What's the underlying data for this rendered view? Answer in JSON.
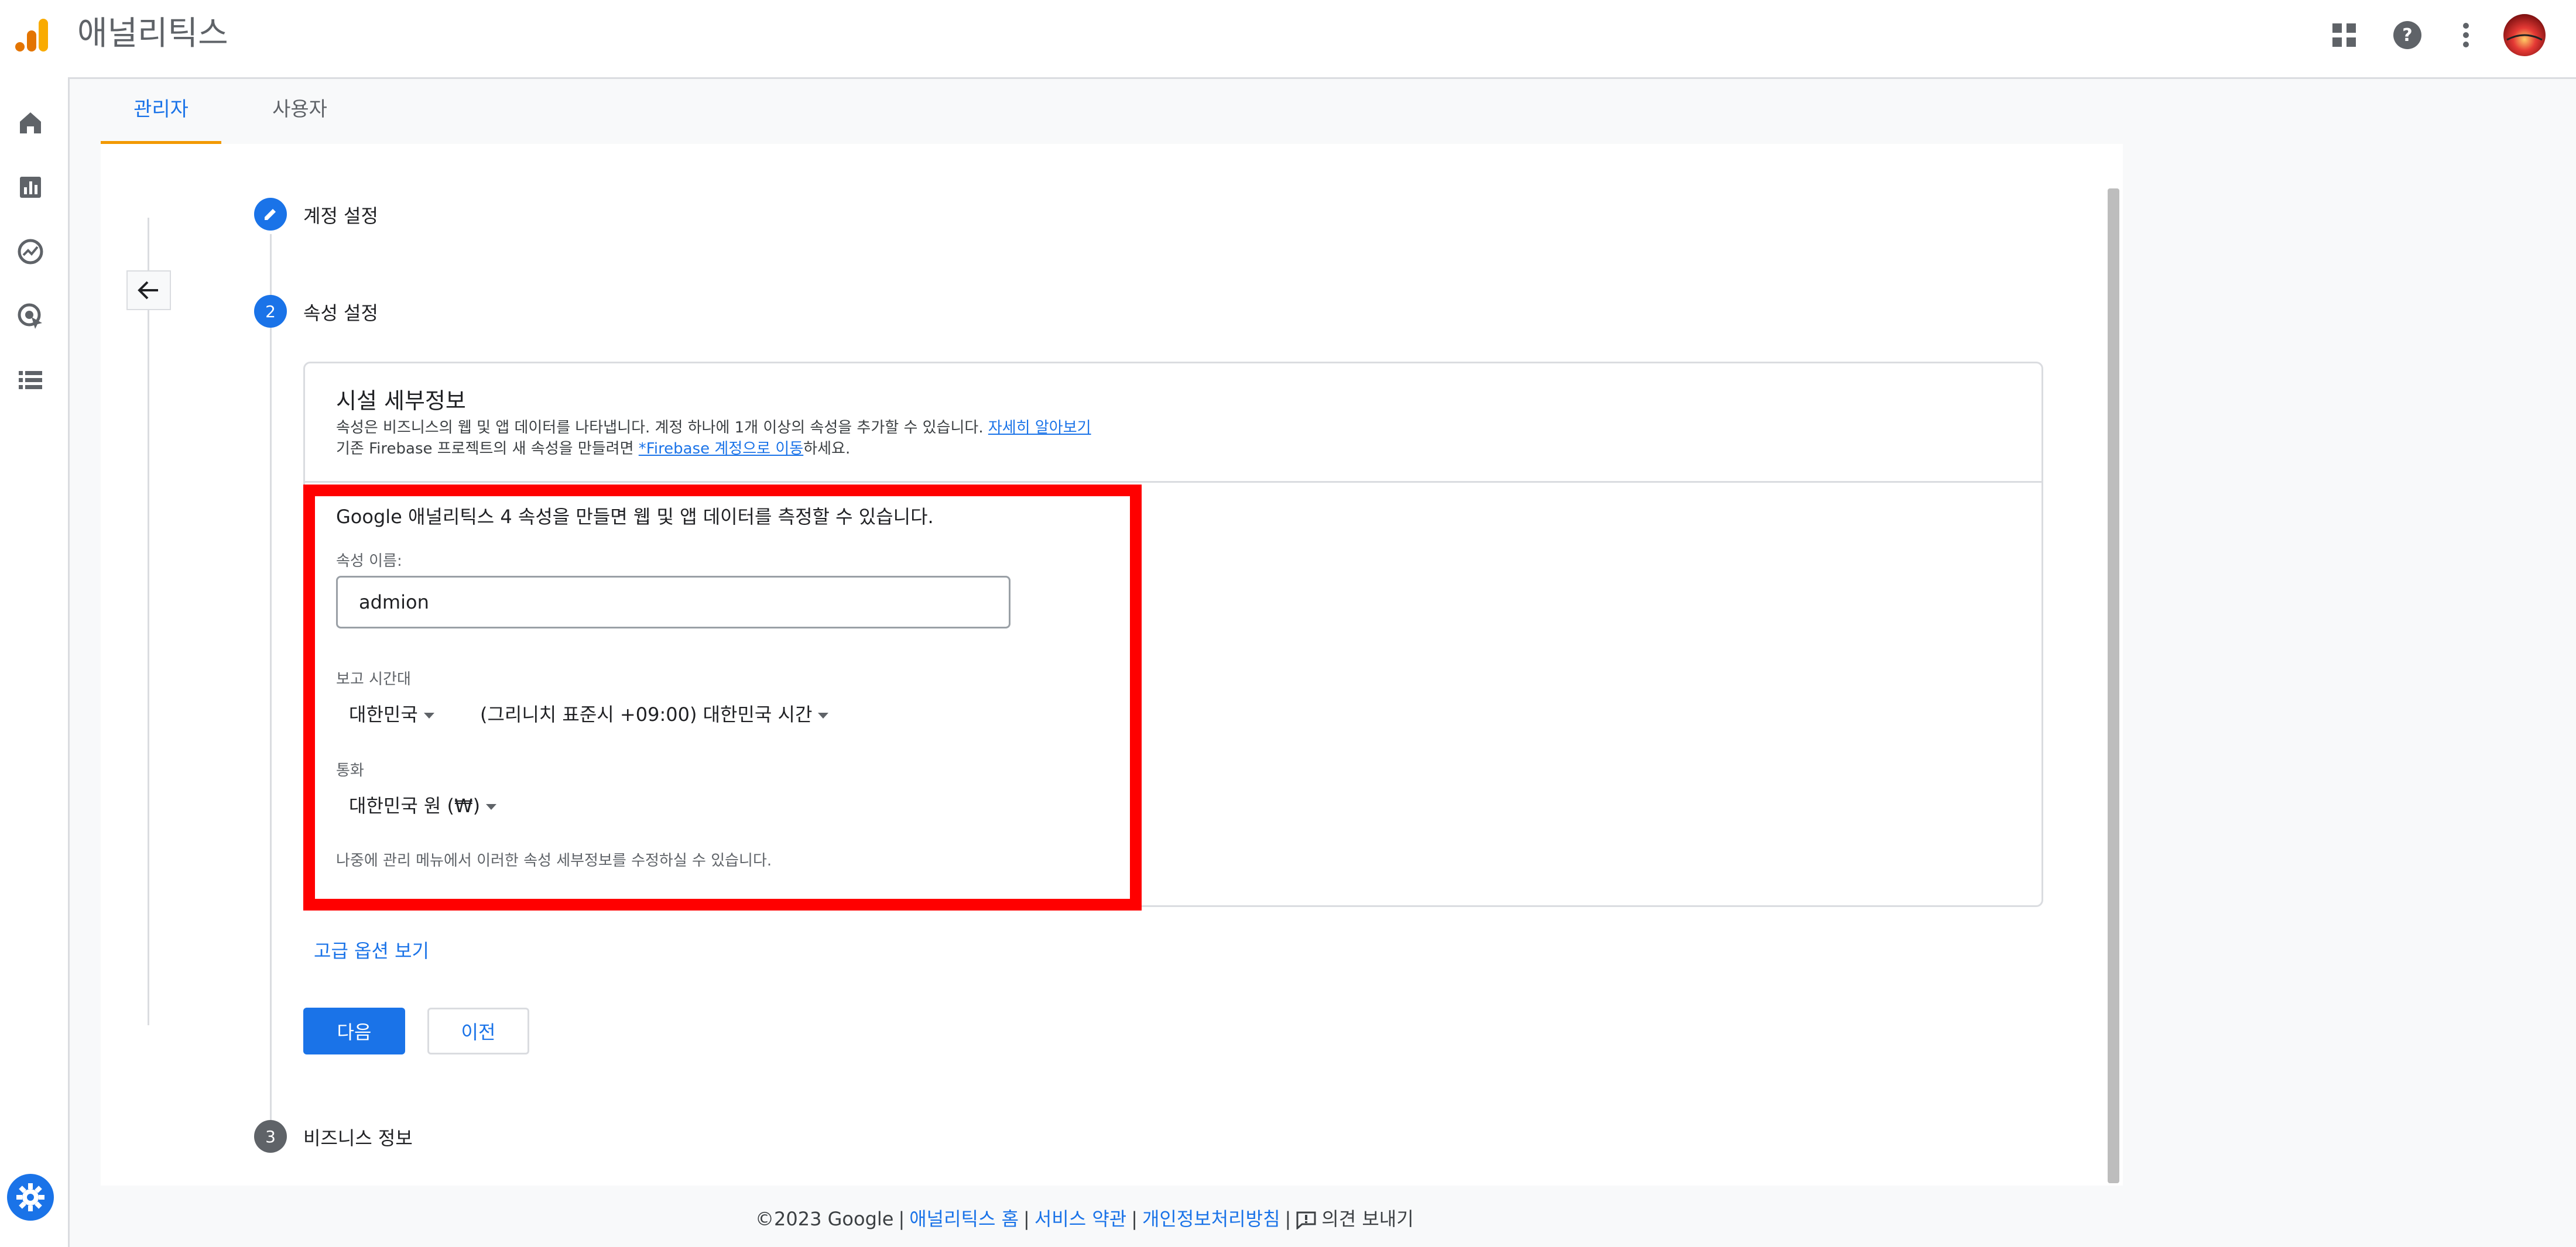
{
  "app": {
    "title": "애널리틱스"
  },
  "tabs": [
    {
      "label": "관리자",
      "active": true
    },
    {
      "label": "사용자",
      "active": false
    }
  ],
  "rail_icons": [
    "home-icon",
    "bar-chart-icon",
    "explore-icon",
    "advertising-icon",
    "list-icon"
  ],
  "steps": [
    {
      "number": "",
      "label": "계정 설정",
      "status": "done"
    },
    {
      "number": "2",
      "label": "속성 설정",
      "status": "active"
    },
    {
      "number": "3",
      "label": "비즈니스 정보",
      "status": "pending"
    }
  ],
  "card": {
    "title": "시설 세부정보",
    "desc1": "속성은 비즈니스의 웹 및 앱 데이터를 나타냅니다. 계정 하나에 1개 이상의 속성을 추가할 수 있습니다.",
    "desc1_link": "자세히 알아보기",
    "desc2_pre": "기존 Firebase 프로젝트의 새 속성을 만들려면 ",
    "desc2_link": "*Firebase 계정으로 이동",
    "desc2_post": "하세요."
  },
  "form": {
    "headline": "Google 애널리틱스 4 속성을 만들면 웹 및 앱 데이터를 측정할 수 있습니다.",
    "property_name_label": "속성 이름:",
    "property_name_value": "admion",
    "timezone_label": "보고 시간대",
    "country_value": "대한민국",
    "timezone_value": "(그리니치 표준시 +09:00) 대한민국 시간",
    "currency_label": "통화",
    "currency_value": "대한민국 원 (₩)",
    "note": "나중에 관리 메뉴에서 이러한 속성 세부정보를 수정하실 수 있습니다."
  },
  "advanced_label": "고급 옵션 보기",
  "buttons": {
    "next": "다음",
    "prev": "이전"
  },
  "footer": {
    "copyright": "©2023 Google",
    "home": "애널리틱스 홈",
    "terms": "서비스 약관",
    "privacy": "개인정보처리방침",
    "feedback": "의견 보내기"
  },
  "colors": {
    "accent": "#1a73e8",
    "tab_indicator": "#f29900",
    "highlight": "#ff0000"
  }
}
